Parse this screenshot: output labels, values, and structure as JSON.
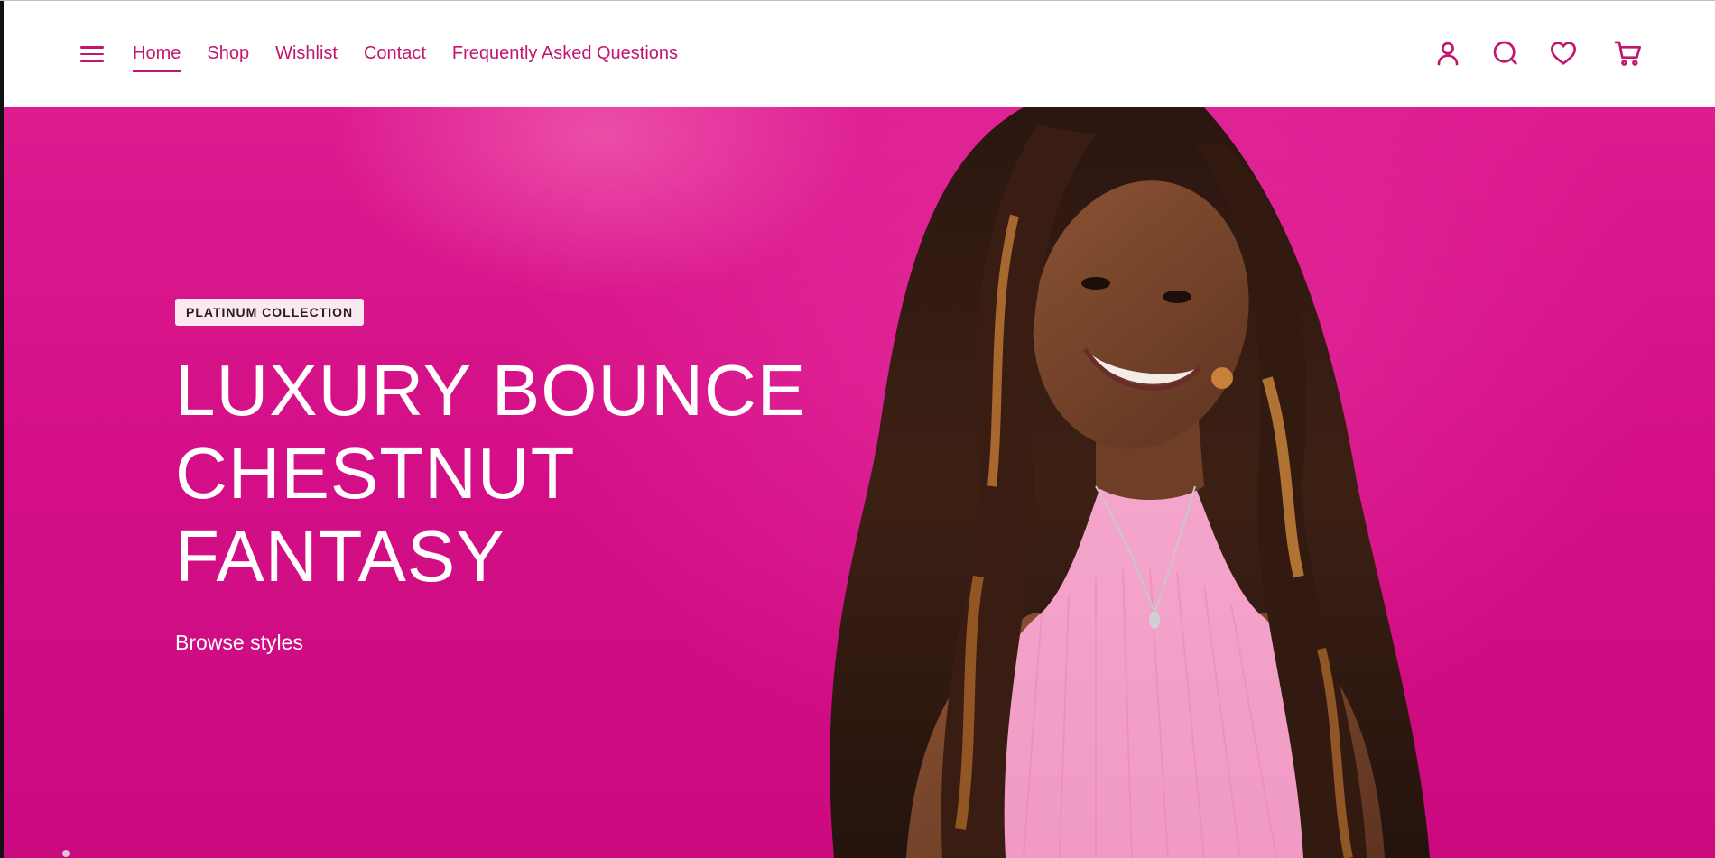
{
  "header": {
    "nav": [
      {
        "label": "Home",
        "active": true
      },
      {
        "label": "Shop",
        "active": false
      },
      {
        "label": "Wishlist",
        "active": false
      },
      {
        "label": "Contact",
        "active": false
      },
      {
        "label": "Frequently Asked Questions",
        "active": false
      }
    ],
    "icons": [
      "menu-icon",
      "account-icon",
      "search-icon",
      "heart-icon",
      "cart-icon"
    ]
  },
  "hero": {
    "badge": "PLATINUM COLLECTION",
    "headline_lines": [
      "LUXURY BOUNCE",
      "CHESTNUT",
      "FANTASY"
    ],
    "cta": "Browse styles"
  },
  "colors": {
    "accent": "#c2166e",
    "hero_background": "#d40f87",
    "badge_background": "#fbe9f2",
    "header_background": "#ffffff"
  }
}
